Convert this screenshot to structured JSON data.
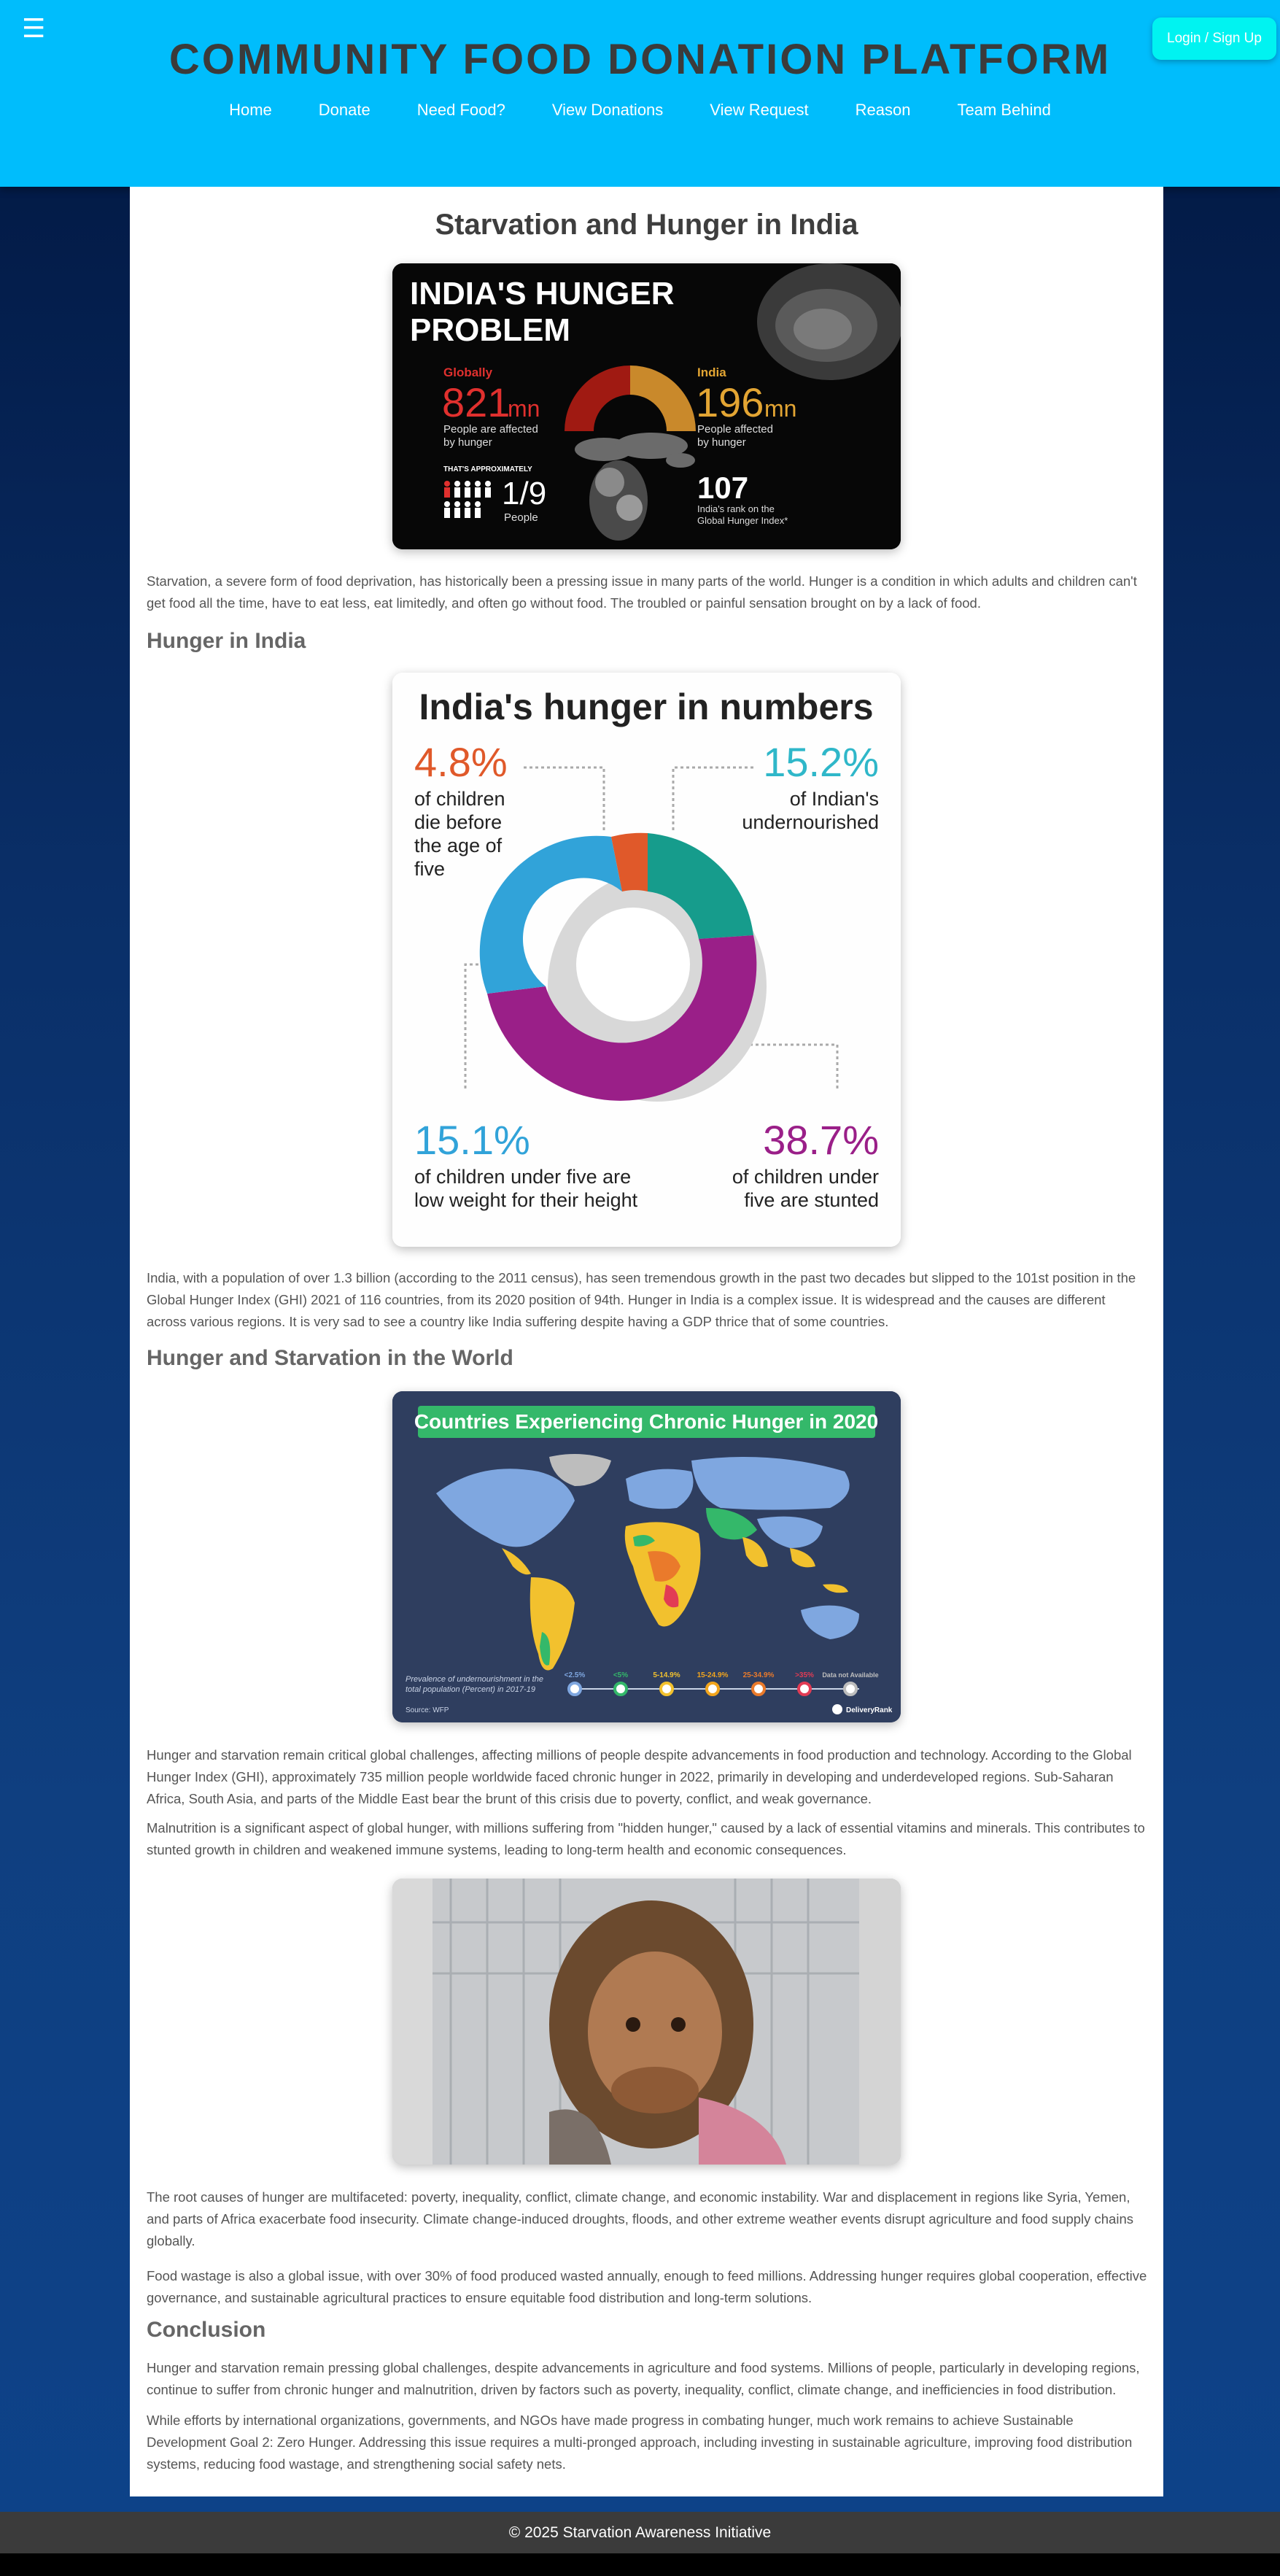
{
  "header": {
    "title": "COMMUNITY FOOD DONATION PLATFORM",
    "login_label": "Login / Sign Up",
    "menu_icon": "hamburger-icon",
    "nav": [
      "Home",
      "Donate",
      "Need Food?",
      "View Donations",
      "View Request",
      "Reason",
      "Team Behind"
    ]
  },
  "main": {
    "title": "Starvation and Hunger in India",
    "infographic1": {
      "title_line1": "INDIA'S HUNGER",
      "title_line2": "PROBLEM",
      "global_label": "Globally",
      "global_value": "821",
      "global_unit": "mn",
      "global_desc1": "People are affected",
      "global_desc2": "by hunger",
      "approx_label": "THAT'S APPROXIMATELY",
      "fraction": "1/9",
      "fraction_label": "People",
      "india_label": "India",
      "india_value": "196",
      "india_unit": "mn",
      "india_desc1": "People affected",
      "india_desc2": "by hunger",
      "rank": "107",
      "rank_desc1": "India's rank on the",
      "rank_desc2": "Global Hunger Index*"
    },
    "para1": "Starvation, a severe form of food deprivation, has historically been a pressing issue in many parts of the world. Hunger is a condition in which adults and children can't get food all the time, have to eat less, eat limitedly, and often go without food. The troubled or painful sensation brought on by a lack of food.",
    "h_india": "Hunger in India",
    "infographic2": {
      "title": "India's hunger in numbers",
      "stat1_value": "4.8%",
      "stat1_l1": "of children",
      "stat1_l2": "die before",
      "stat1_l3": "the age of",
      "stat1_l4": "five",
      "stat2_value": "15.2%",
      "stat2_l1": "of Indian's",
      "stat2_l2": "undernourished",
      "stat3_value": "15.1%",
      "stat3_l1": "of children under five are",
      "stat3_l2": "low weight for their height",
      "stat4_value": "38.7%",
      "stat4_l1": "of children under",
      "stat4_l2": "five are stunted",
      "colors": {
        "orange": "#e0592a",
        "teal": "#169c8c",
        "blue": "#31a3d9",
        "purple": "#9a1f88"
      }
    },
    "para2": "India, with a population of over 1.3 billion (according to the 2011 census), has seen tremendous growth in the past two decades but slipped to the 101st position in the Global Hunger Index (GHI) 2021 of 116 countries, from its 2020 position of 94th. Hunger in India is a complex issue. It is widespread and the causes are different across various regions. It is very sad to see a country like India suffering despite having a GDP thrice that of some countries.",
    "h_world": "Hunger and Starvation in the World",
    "infographic3": {
      "title": "Countries Experiencing Chronic Hunger in 2020",
      "legend_caption1": "Prevalence of undernourishment in the",
      "legend_caption2": "total population (Percent) in 2017-19",
      "legend": [
        "<2.5%",
        "<5%",
        "5-14.9%",
        "15-24.9%",
        "25-34.9%",
        ">35%",
        "Data not Available"
      ],
      "legend_colors": [
        "#7fa7e0",
        "#34b86a",
        "#f2c12e",
        "#f2a51d",
        "#ea7a2b",
        "#e23b54",
        "#bdbdbd"
      ],
      "source": "Source: WFP",
      "brand": "DeliveryRank"
    },
    "para3": "Hunger and starvation remain critical global challenges, affecting millions of people despite advancements in food production and technology. According to the Global Hunger Index (GHI), approximately 735 million people worldwide faced chronic hunger in 2022, primarily in developing and underdeveloped regions. Sub-Saharan Africa, South Asia, and parts of the Middle East bear the brunt of this crisis due to poverty, conflict, and weak governance.",
    "para4": "Malnutrition is a significant aspect of global hunger, with millions suffering from \"hidden hunger,\" caused by a lack of essential vitamins and minerals. This contributes to stunted growth in children and weakened immune systems, leading to long-term health and economic consequences.",
    "para5": "The root causes of hunger are multifaceted: poverty, inequality, conflict, climate change, and economic instability. War and displacement in regions like Syria, Yemen, and parts of Africa exacerbate food insecurity. Climate change-induced droughts, floods, and other extreme weather events disrupt agriculture and food supply chains globally.",
    "para6": "Food wastage is also a global issue, with over 30% of food produced wasted annually, enough to feed millions. Addressing hunger requires global cooperation, effective governance, and sustainable agricultural practices to ensure equitable food distribution and long-term solutions.",
    "h_conclusion": "Conclusion",
    "para7": "Hunger and starvation remain pressing global challenges, despite advancements in agriculture and food systems. Millions of people, particularly in developing regions, continue to suffer from chronic hunger and malnutrition, driven by factors such as poverty, inequality, conflict, climate change, and inefficiencies in food distribution.",
    "para8": "While efforts by international organizations, governments, and NGOs have made progress in combating hunger, much work remains to achieve Sustainable Development Goal 2: Zero Hunger. Addressing this issue requires a multi-pronged approach, including investing in sustainable agriculture, improving food distribution systems, reducing food wastage, and strengthening social safety nets."
  },
  "footer": {
    "text": "© 2025 Starvation Awareness Initiative"
  }
}
